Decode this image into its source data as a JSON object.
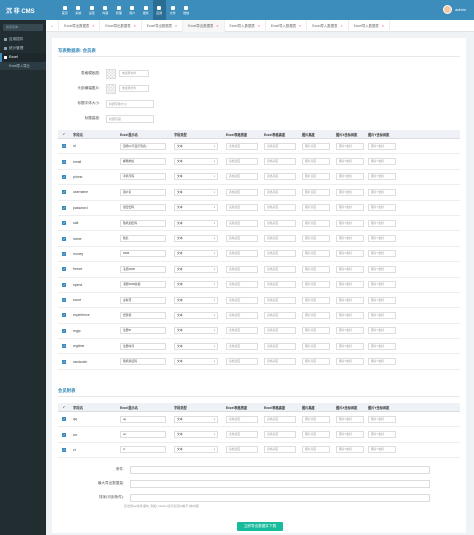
{
  "app": {
    "logo": "沉 非 CMS",
    "user_name": "admin"
  },
  "topnav": [
    {
      "label": "首页"
    },
    {
      "label": "系统"
    },
    {
      "label": "设置"
    },
    {
      "label": "内容"
    },
    {
      "label": "管理"
    },
    {
      "label": "用户"
    },
    {
      "label": "插件"
    },
    {
      "label": "应用"
    },
    {
      "label": "文件"
    },
    {
      "label": "微信"
    }
  ],
  "sidebar": {
    "search_placeholder": "搜索菜单...",
    "items": [
      {
        "label": "应用插件"
      },
      {
        "label": "统计管理"
      },
      {
        "label": "Excel"
      }
    ],
    "sub_items": [
      {
        "label": "Excel导入导出"
      }
    ]
  },
  "tabs": [
    {
      "label": "Excel导出数据表"
    },
    {
      "label": "Excel导出数据表"
    },
    {
      "label": "Excel导出数据表"
    },
    {
      "label": "Excel导出数据表"
    },
    {
      "label": "Excel导入数据表"
    },
    {
      "label": "Excel导入数据表"
    },
    {
      "label": "Excel导入数据表"
    },
    {
      "label": "Excel导入数据表"
    }
  ],
  "form": {
    "section1_title": "写表数据表: 会员表",
    "img1_label": "表格模板图:",
    "img2_label": "头部横幅图片:",
    "file_placeholder": "未选择文件",
    "header_size_label": "标题字体大小:",
    "header_size_placeholder": "标题字体大小",
    "header_height_label": "标题高度:",
    "header_height_placeholder": "标题高度"
  },
  "table_headers": {
    "chk": "✓",
    "field": "字段名",
    "display": "Excel显示名",
    "type": "字段类型",
    "width": "Excel表格宽度",
    "height": "Excel表格高度",
    "img_w": "图片高度",
    "img_x": "图片X坐标间距",
    "img_y": "图片Y坐标间距"
  },
  "placeholders": {
    "width": "表格宽度",
    "height": "表格高度",
    "img_h": "图片高度",
    "img_x": "图片X坐标",
    "img_y": "图片Y坐标"
  },
  "type_value": "文本",
  "rows": [
    {
      "field": "id",
      "display": "自增id(不显示到表)"
    },
    {
      "field": "email",
      "display": "邮箱地址"
    },
    {
      "field": "phone",
      "display": "手机号码"
    },
    {
      "field": "username",
      "display": "用户名"
    },
    {
      "field": "password",
      "display": "加密密码"
    },
    {
      "field": "salt",
      "display": "随机加密码"
    },
    {
      "field": "name",
      "display": "姓名"
    },
    {
      "field": "money",
      "display": "RMB"
    },
    {
      "field": "freeze",
      "display": "冻结RMB"
    },
    {
      "field": "spend",
      "display": "消费RMB总额"
    },
    {
      "field": "score",
      "display": "虚拟币"
    },
    {
      "field": "experience",
      "display": "经验值"
    },
    {
      "field": "regip",
      "display": "注册IP"
    },
    {
      "field": "regtime",
      "display": "注册时间"
    },
    {
      "field": "randcode",
      "display": "随机验证码"
    }
  ],
  "section2_title": "会员附表",
  "rows2": [
    {
      "field": "qq",
      "display": "qq"
    },
    {
      "field": "wx",
      "display": "wx"
    },
    {
      "field": "zt",
      "display": "zt"
    }
  ],
  "footer_form": {
    "where_label": "条件:",
    "max_label": "最大导出数据量:",
    "order_label": "排序(可用条件):",
    "help": "仅支持sql条件语句, 例如: catid=1表示栏目id等于1的内容",
    "submit": "立即导出数据并下载"
  }
}
